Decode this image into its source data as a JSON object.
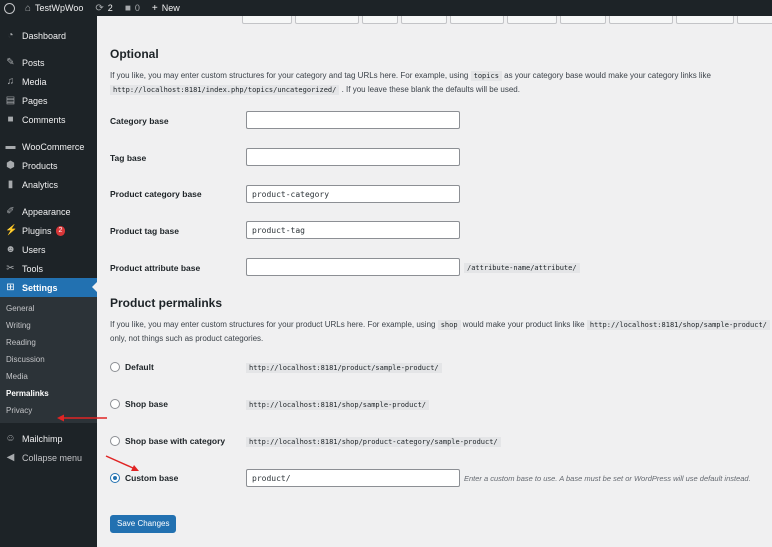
{
  "adminbar": {
    "site_name": "TestWpWoo",
    "updates_count": "2",
    "comments_count": "0",
    "new_label": "New"
  },
  "sidebar": {
    "items": [
      {
        "label": "Dashboard",
        "icon": "dashboard-icon"
      },
      {
        "label": "Posts",
        "icon": "pin-icon"
      },
      {
        "label": "Media",
        "icon": "media-icon"
      },
      {
        "label": "Pages",
        "icon": "pages-icon"
      },
      {
        "label": "Comments",
        "icon": "comment-icon"
      },
      {
        "label": "WooCommerce",
        "icon": "woocommerce-icon"
      },
      {
        "label": "Products",
        "icon": "products-icon"
      },
      {
        "label": "Analytics",
        "icon": "analytics-icon"
      },
      {
        "label": "Appearance",
        "icon": "brush-icon"
      },
      {
        "label": "Plugins",
        "icon": "plugin-icon",
        "badge": "2"
      },
      {
        "label": "Users",
        "icon": "users-icon"
      },
      {
        "label": "Tools",
        "icon": "wrench-icon"
      },
      {
        "label": "Settings",
        "icon": "settings-icon"
      },
      {
        "label": "Mailchimp",
        "icon": "mailchimp-icon"
      },
      {
        "label": "Collapse menu",
        "icon": "collapse-icon"
      }
    ],
    "settings_submenu": [
      "General",
      "Writing",
      "Reading",
      "Discussion",
      "Media",
      "Permalinks",
      "Privacy"
    ],
    "active_submenu": "Permalinks"
  },
  "optional": {
    "heading": "Optional",
    "desc_line1_a": "If you like, you may enter custom structures for your category and tag URLs here. For example, using",
    "desc_code1": "topics",
    "desc_line1_b": "as your category base would make your category links like",
    "desc_code2": "http://localhost:8181/index.php/topics/uncategorized/",
    "desc_line2_b": ". If you leave these blank the defaults will be used.",
    "fields": [
      {
        "label": "Category base",
        "value": ""
      },
      {
        "label": "Tag base",
        "value": ""
      },
      {
        "label": "Product category base",
        "value": "product-category"
      },
      {
        "label": "Product tag base",
        "value": "product-tag"
      },
      {
        "label": "Product attribute base",
        "value": "",
        "suffix": "/attribute-name/attribute/"
      }
    ]
  },
  "product_permalinks": {
    "heading": "Product permalinks",
    "desc_a": "If you like, you may enter custom structures for your product URLs here. For example, using",
    "desc_code1": "shop",
    "desc_b": "would make your product links like",
    "desc_code2": "http://localhost:8181/shop/sample-product/",
    "desc_line2": "only, not things such as product categories.",
    "options": [
      {
        "label": "Default",
        "example": "http://localhost:8181/product/sample-product/",
        "checked": false
      },
      {
        "label": "Shop base",
        "example": "http://localhost:8181/shop/sample-product/",
        "checked": false
      },
      {
        "label": "Shop base with category",
        "example": "http://localhost:8181/shop/product-category/sample-product/",
        "checked": false
      },
      {
        "label": "Custom base",
        "value": "product/",
        "checked": true,
        "hint": "Enter a custom base to use. A base must be set or WordPress will use default instead."
      }
    ]
  },
  "save_button": "Save Changes",
  "colors": {
    "accent": "#2271b1",
    "annotation": "#e02424",
    "adminbar": "#1d2327"
  }
}
